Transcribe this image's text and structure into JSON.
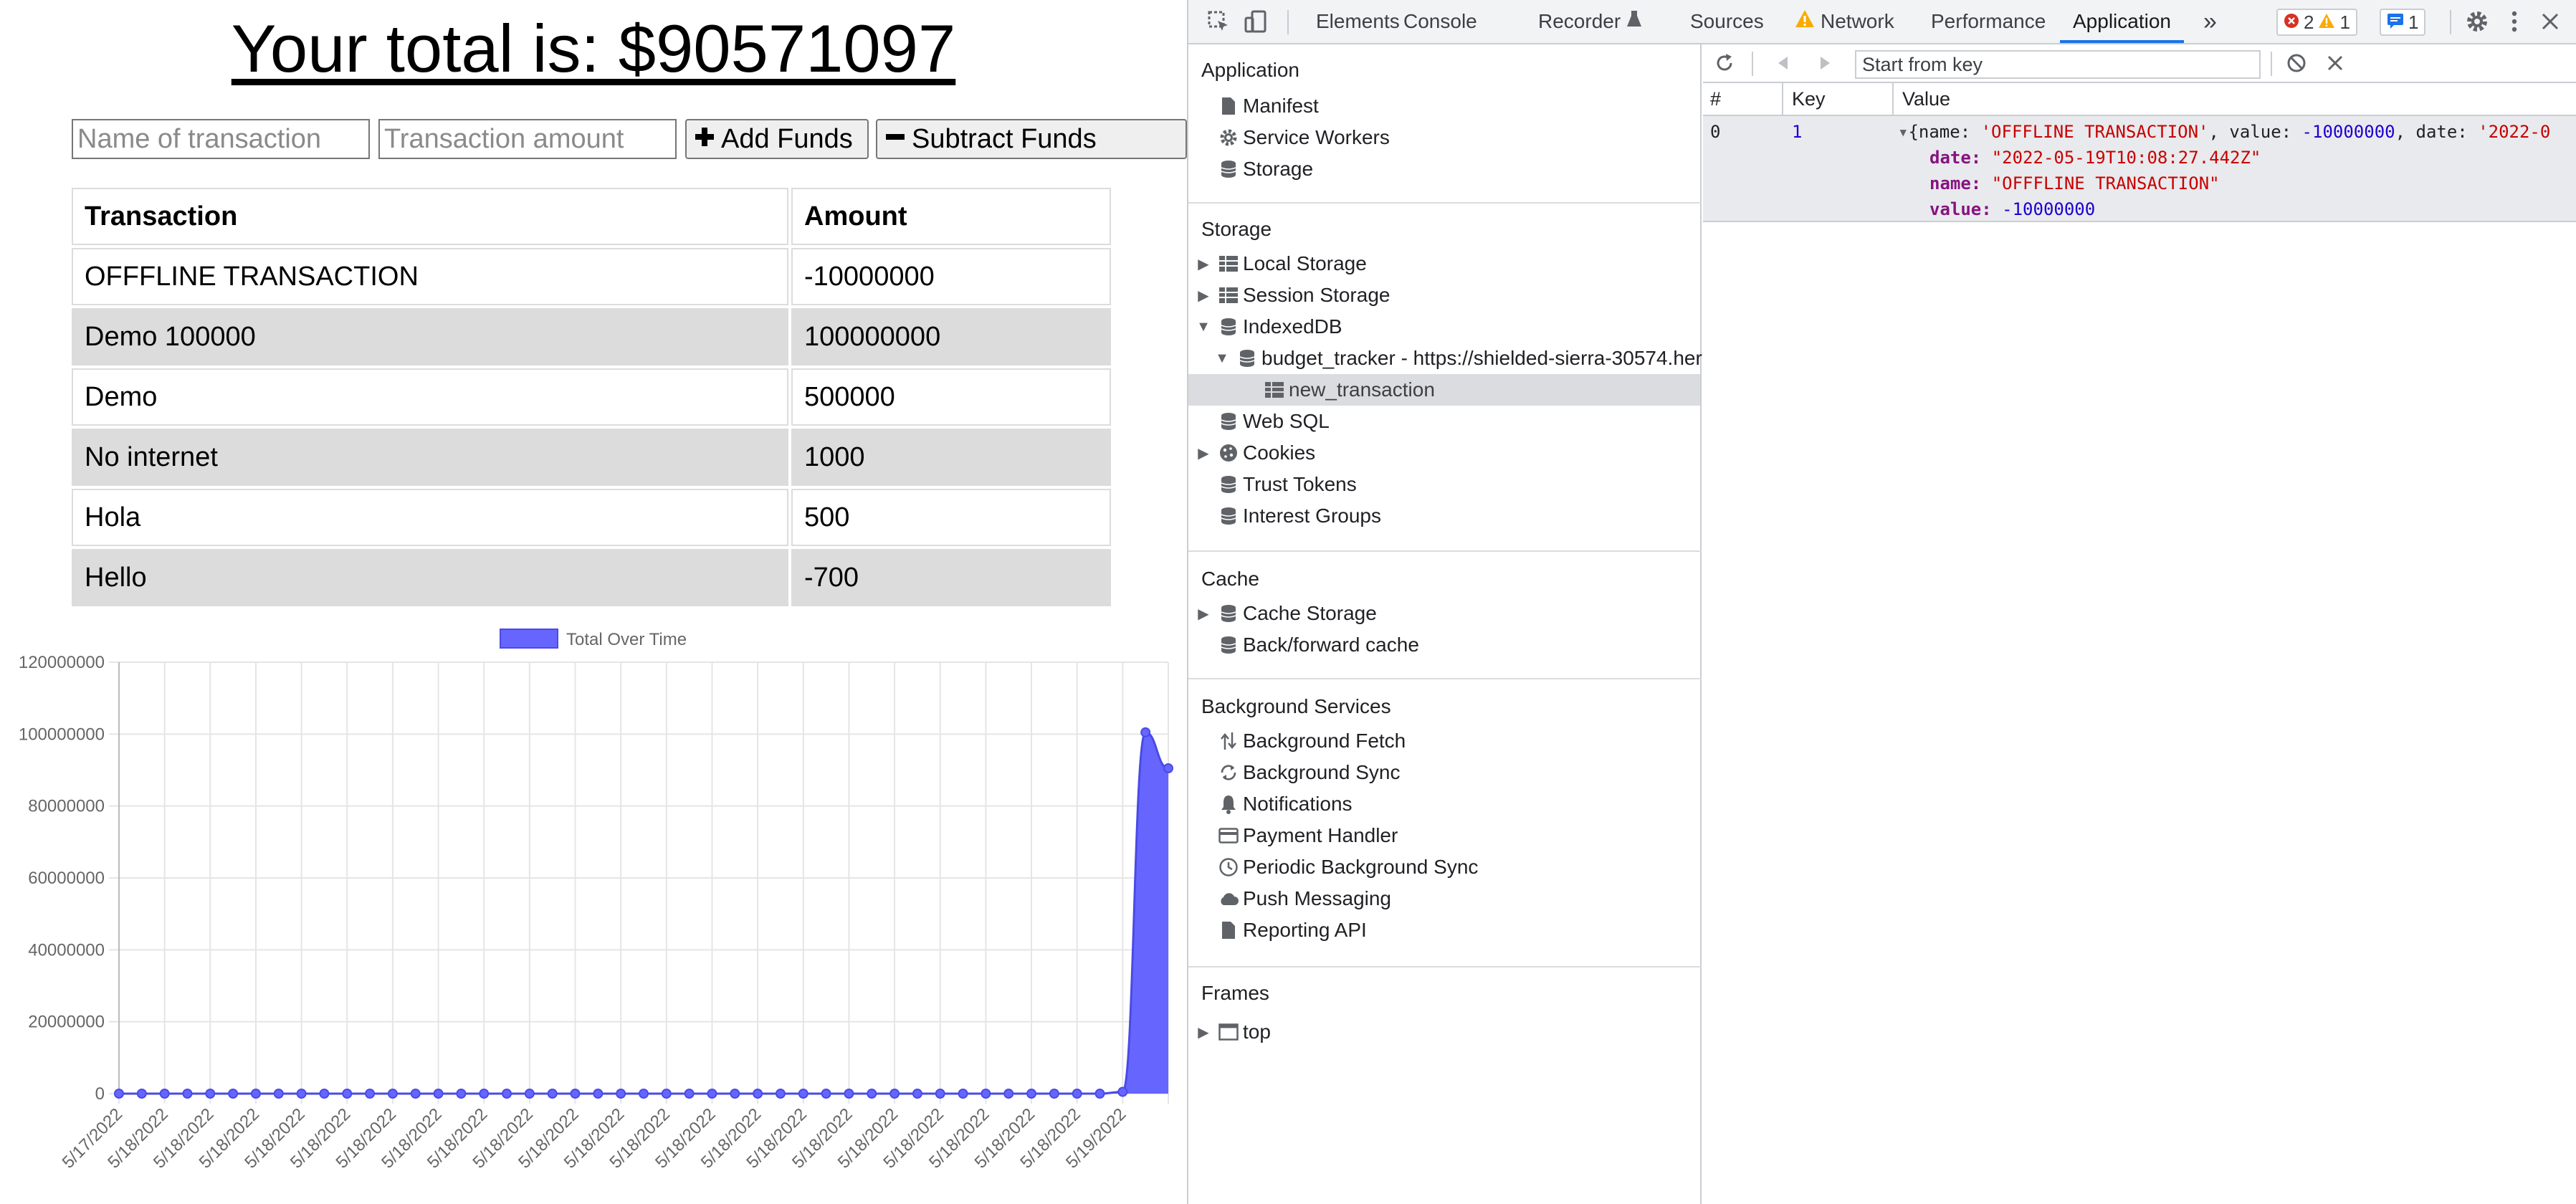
{
  "app": {
    "total_text": "Your total is: $90571097",
    "name_placeholder": "Name of transaction",
    "amount_placeholder": "Transaction amount",
    "add_label": "Add Funds",
    "subtract_label": "Subtract Funds",
    "table": {
      "headers": [
        "Transaction",
        "Amount"
      ],
      "rows": [
        [
          "OFFFLINE TRANSACTION",
          "-10000000"
        ],
        [
          "Demo 100000",
          "100000000"
        ],
        [
          "Demo",
          "500000"
        ],
        [
          "No internet",
          "1000"
        ],
        [
          "Hola",
          "500"
        ],
        [
          "Hello",
          "-700"
        ]
      ]
    }
  },
  "chart_data": {
    "type": "area",
    "legend": "Total Over Time",
    "legend_position": "top-center",
    "series_color": "#6666ff",
    "ylim": [
      0,
      120000000
    ],
    "y_ticks": [
      "0",
      "20000000",
      "40000000",
      "60000000",
      "80000000",
      "100000000",
      "120000000"
    ],
    "x": [
      "5/17/2022",
      "5/18/2022",
      "5/18/2022",
      "5/18/2022",
      "5/18/2022",
      "5/18/2022",
      "5/18/2022",
      "5/18/2022",
      "5/18/2022",
      "5/18/2022",
      "5/18/2022",
      "5/18/2022",
      "5/18/2022",
      "5/18/2022",
      "5/18/2022",
      "5/18/2022",
      "5/18/2022",
      "5/18/2022",
      "5/18/2022",
      "5/18/2022",
      "5/18/2022",
      "5/18/2022",
      "5/18/2022",
      "5/18/2022",
      "5/18/2022",
      "5/18/2022",
      "5/18/2022",
      "5/18/2022",
      "5/18/2022",
      "5/18/2022",
      "5/18/2022",
      "5/18/2022",
      "5/18/2022",
      "5/18/2022",
      "5/18/2022",
      "5/18/2022",
      "5/18/2022",
      "5/18/2022",
      "5/18/2022",
      "5/18/2022",
      "5/18/2022",
      "5/18/2022",
      "5/18/2022",
      "5/18/2022",
      "5/19/2022",
      "5/19/2022",
      "5/19/2022"
    ],
    "x_tick_labels": [
      "5/17/2022",
      "5/18/2022",
      "5/18/2022",
      "5/18/2022",
      "5/18/2022",
      "5/18/2022",
      "5/18/2022",
      "5/18/2022",
      "5/18/2022",
      "5/18/2022",
      "5/18/2022",
      "5/18/2022",
      "5/18/2022",
      "5/18/2022",
      "5/18/2022",
      "5/18/2022",
      "5/18/2022",
      "5/18/2022",
      "5/18/2022",
      "5/18/2022",
      "5/18/2022",
      "5/18/2022",
      "5/19/2022"
    ],
    "values": [
      0,
      0,
      0,
      0,
      0,
      0,
      0,
      0,
      0,
      0,
      0,
      0,
      0,
      0,
      0,
      0,
      0,
      0,
      0,
      0,
      0,
      0,
      0,
      0,
      0,
      0,
      0,
      0,
      0,
      0,
      0,
      0,
      0,
      0,
      0,
      0,
      0,
      0,
      0,
      0,
      0,
      0,
      0,
      0,
      500000,
      100500000,
      90500000
    ],
    "grid": true
  },
  "devtools": {
    "tabs": [
      "Elements",
      "Console",
      "Recorder",
      "Sources",
      "Network",
      "Performance",
      "Application"
    ],
    "active_tab": "Application",
    "more_tabs": "»",
    "errors": "2",
    "warnings": "1",
    "messages": "1",
    "sidebar": {
      "application_header": "Application",
      "application_items": [
        "Manifest",
        "Service Workers",
        "Storage"
      ],
      "storage_header": "Storage",
      "storage_items": [
        "Local Storage",
        "Session Storage",
        "IndexedDB"
      ],
      "db_name": "budget_tracker - https://shielded-sierra-30574.her",
      "store_name": "new_transaction",
      "storage_items_2": [
        "Web SQL",
        "Cookies",
        "Trust Tokens",
        "Interest Groups"
      ],
      "cache_header": "Cache",
      "cache_items": [
        "Cache Storage",
        "Back/forward cache"
      ],
      "bg_header": "Background Services",
      "bg_items": [
        "Background Fetch",
        "Background Sync",
        "Notifications",
        "Payment Handler",
        "Periodic Background Sync",
        "Push Messaging",
        "Reporting API"
      ],
      "frames_header": "Frames",
      "frames_items": [
        "top"
      ]
    },
    "db": {
      "start_placeholder": "Start from key",
      "col_num": "#",
      "col_key": "Key",
      "col_value": "Value",
      "row_index": "0",
      "row_key": "1",
      "summary_open": "{name: ",
      "summary_name": "'OFFFLINE TRANSACTION'",
      "summary_mid": ", value: ",
      "summary_value": "-10000000",
      "summary_mid2": ", date: ",
      "summary_date": "'2022-0",
      "date_key": "date",
      "date_val": "\"2022-05-19T10:08:27.442Z\"",
      "name_key": "name",
      "name_val": "\"OFFFLINE TRANSACTION\"",
      "value_key": "value",
      "value_val": "-10000000"
    }
  }
}
